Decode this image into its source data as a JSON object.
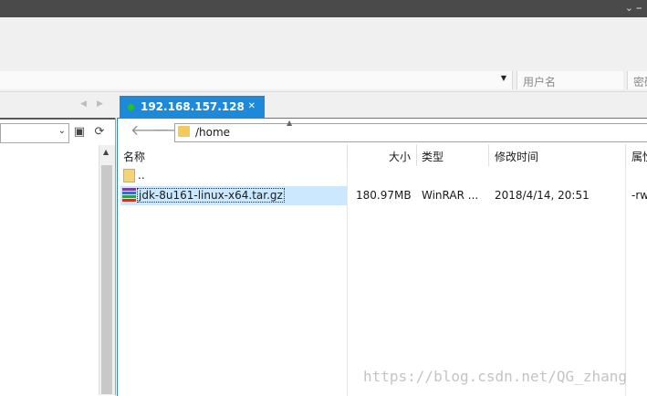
{
  "window": {
    "controls": "⌄  ⎯"
  },
  "address_bar": {
    "user_placeholder": "用户名",
    "password_placeholder": "密码"
  },
  "session_tab": {
    "label": "192.168.157.128",
    "status_color": "#22c322"
  },
  "remote": {
    "path": "/home",
    "columns": {
      "name": "名称",
      "size": "大小",
      "type": "类型",
      "modified": "修改时间",
      "attributes": "属性"
    },
    "rows": [
      {
        "name": "..",
        "size": "",
        "type": "",
        "modified": "",
        "attributes": "",
        "icon": "folder-icon"
      },
      {
        "name": "jdk-8u161-linux-x64.tar.gz",
        "size": "180.97MB",
        "type": "WinRAR ...",
        "modified": "2018/4/14, 20:51",
        "attributes": "-rw",
        "icon": "winrar-archive-icon",
        "selected": true
      }
    ]
  },
  "watermark": "https://blog.csdn.net/QG_zhang",
  "colors": {
    "accent": "#1d89d8",
    "selection": "#cce8ff",
    "titlebar": "#4a4a4a"
  }
}
